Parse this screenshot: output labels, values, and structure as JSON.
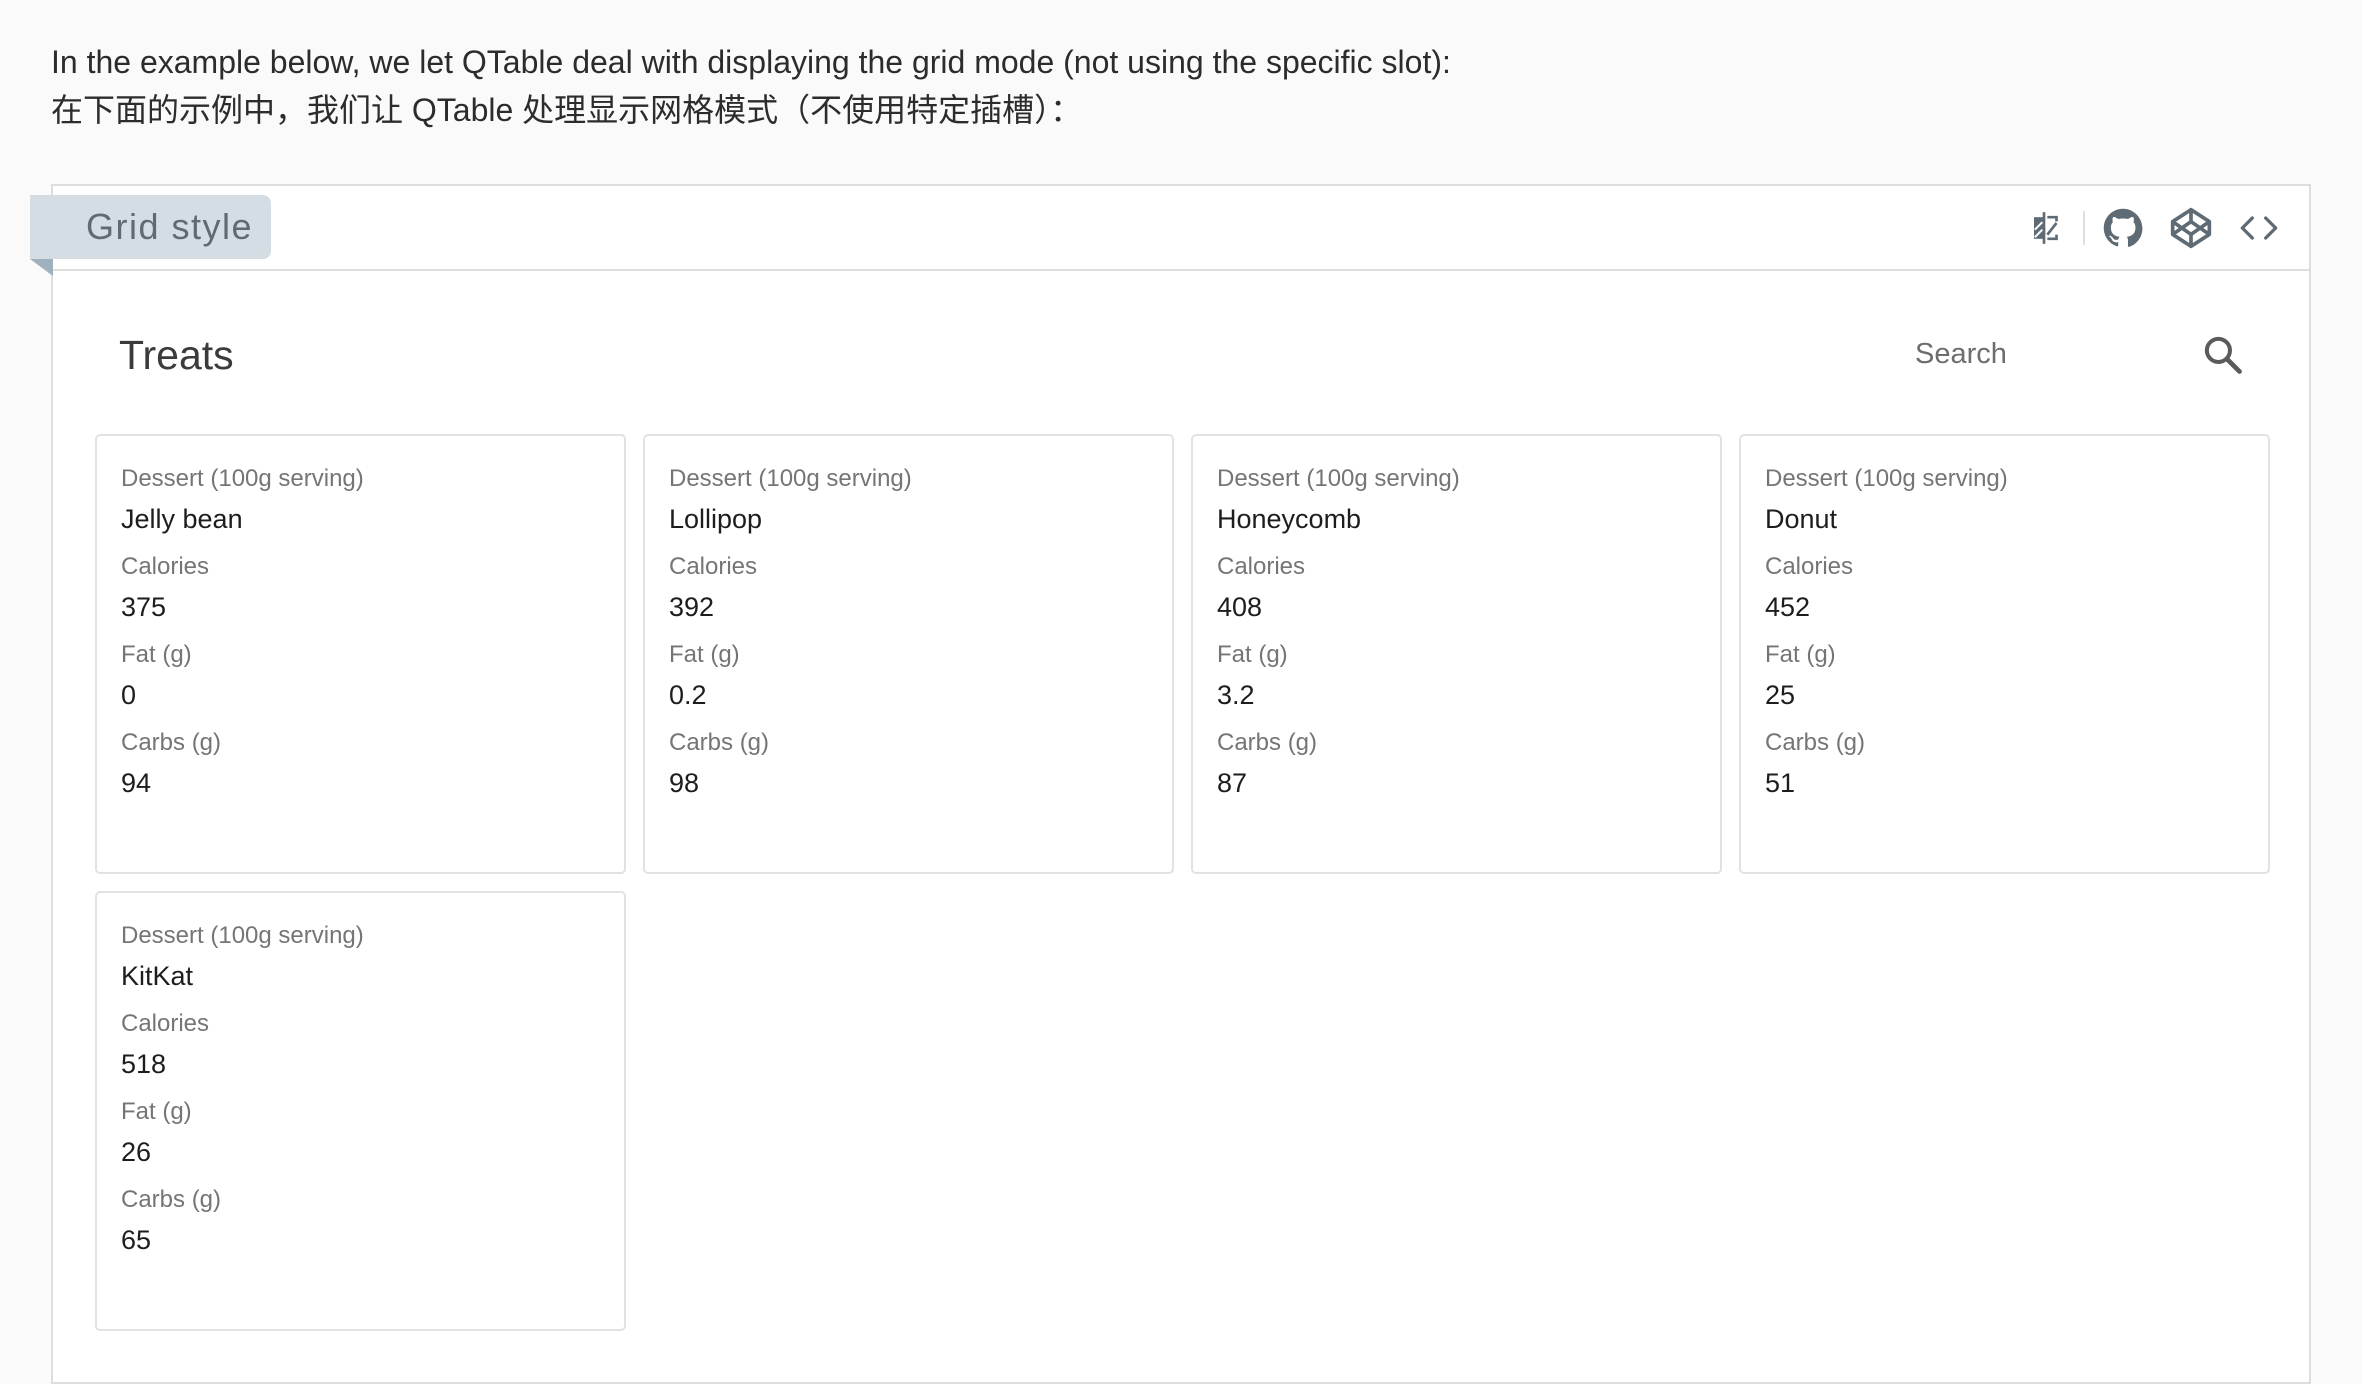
{
  "intro": {
    "line_en": "In the example below, we let QTable deal with displaying the grid mode (not using the specific slot):",
    "line_zh": "在下面的示例中，我们让 QTable 处理显示网格模式（不使用特定插槽）："
  },
  "example": {
    "title": "Grid style",
    "actions": [
      "contrast-icon",
      "github-icon",
      "codepen-icon",
      "code-icon"
    ]
  },
  "table": {
    "title": "Treats",
    "search": {
      "placeholder": "Search",
      "value": ""
    },
    "labels": {
      "name": "Dessert (100g serving)",
      "calories": "Calories",
      "fat": "Fat (g)",
      "carbs": "Carbs (g)"
    },
    "rows": [
      {
        "name": "Jelly bean",
        "calories": "375",
        "fat": "0",
        "carbs": "94"
      },
      {
        "name": "Lollipop",
        "calories": "392",
        "fat": "0.2",
        "carbs": "98"
      },
      {
        "name": "Honeycomb",
        "calories": "408",
        "fat": "3.2",
        "carbs": "87"
      },
      {
        "name": "Donut",
        "calories": "452",
        "fat": "25",
        "carbs": "51"
      },
      {
        "name": "KitKat",
        "calories": "518",
        "fat": "26",
        "carbs": "65"
      }
    ]
  }
}
